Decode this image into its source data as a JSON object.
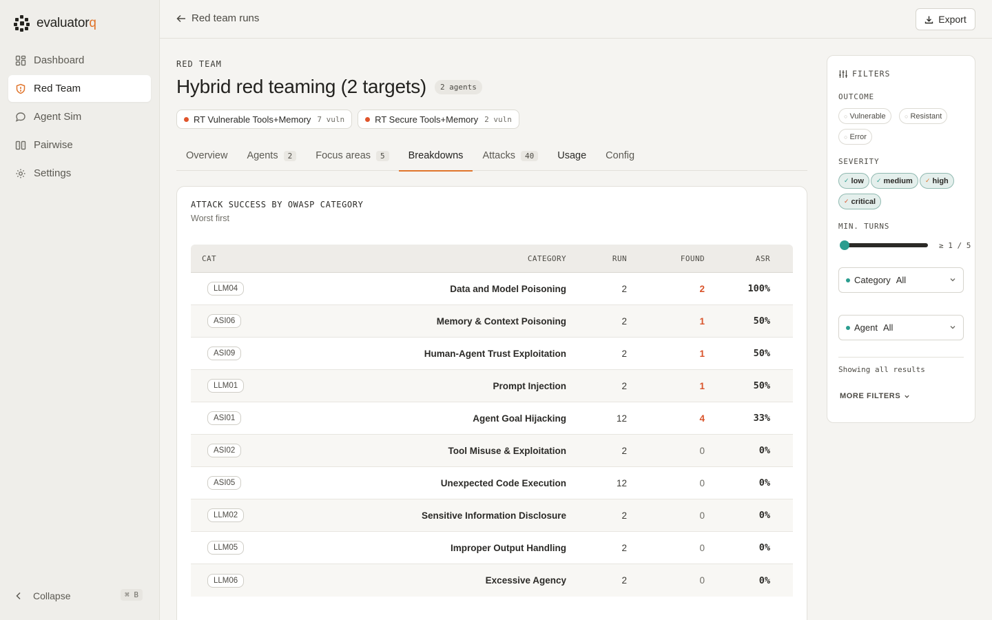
{
  "app": {
    "logo_text": "evaluator",
    "logo_accent": "q",
    "accent_color": "#e0742b",
    "teal_color": "#2a9d8f"
  },
  "sidebar": {
    "items": [
      {
        "label": "Dashboard",
        "icon": "dashboard-icon"
      },
      {
        "label": "Red Team",
        "icon": "shield-icon",
        "active": true
      },
      {
        "label": "Agent Sim",
        "icon": "chat-bubble-icon"
      },
      {
        "label": "Pairwise",
        "icon": "columns-icon"
      },
      {
        "label": "Settings",
        "icon": "gear-icon"
      }
    ],
    "collapse_label": "Collapse",
    "collapse_shortcut": "⌘ B"
  },
  "topbar": {
    "back_label": "Red team runs",
    "export_label": "Export"
  },
  "header": {
    "eyebrow": "RED TEAM",
    "title": "Hybrid red teaming (2 targets)",
    "agent_count": "2 agents",
    "targets": [
      {
        "name": "RT Vulnerable Tools+Memory",
        "vuln": "7 vuln"
      },
      {
        "name": "RT Secure Tools+Memory",
        "vuln": "2 vuln"
      }
    ]
  },
  "tabs": [
    {
      "label": "Overview"
    },
    {
      "label": "Agents",
      "badge": "2"
    },
    {
      "label": "Focus areas",
      "badge": "5"
    },
    {
      "label": "Breakdowns",
      "active": true
    },
    {
      "label": "Attacks",
      "badge": "40"
    },
    {
      "label": "Usage"
    },
    {
      "label": "Config"
    }
  ],
  "breakdown": {
    "title": "ATTACK SUCCESS BY OWASP CATEGORY",
    "subtitle": "Worst first",
    "columns": {
      "cat": "CAT",
      "category": "CATEGORY",
      "run": "RUN",
      "found": "FOUND",
      "asr": "ASR"
    },
    "rows": [
      {
        "cat": "LLM04",
        "category": "Data and Model Poisoning",
        "run": "2",
        "found": "2",
        "asr": "100%"
      },
      {
        "cat": "ASI06",
        "category": "Memory & Context Poisoning",
        "run": "2",
        "found": "1",
        "asr": "50%"
      },
      {
        "cat": "ASI09",
        "category": "Human-Agent Trust Exploitation",
        "run": "2",
        "found": "1",
        "asr": "50%"
      },
      {
        "cat": "LLM01",
        "category": "Prompt Injection",
        "run": "2",
        "found": "1",
        "asr": "50%"
      },
      {
        "cat": "ASI01",
        "category": "Agent Goal Hijacking",
        "run": "12",
        "found": "4",
        "asr": "33%"
      },
      {
        "cat": "ASI02",
        "category": "Tool Misuse & Exploitation",
        "run": "2",
        "found": "0",
        "asr": "0%"
      },
      {
        "cat": "ASI05",
        "category": "Unexpected Code Execution",
        "run": "12",
        "found": "0",
        "asr": "0%"
      },
      {
        "cat": "LLM02",
        "category": "Sensitive Information Disclosure",
        "run": "2",
        "found": "0",
        "asr": "0%"
      },
      {
        "cat": "LLM05",
        "category": "Improper Output Handling",
        "run": "2",
        "found": "0",
        "asr": "0%"
      },
      {
        "cat": "LLM06",
        "category": "Excessive Agency",
        "run": "2",
        "found": "0",
        "asr": "0%"
      }
    ]
  },
  "filters": {
    "title": "FILTERS",
    "outcome_label": "OUTCOME",
    "outcomes": [
      "Vulnerable",
      "Resistant",
      "Error"
    ],
    "severity_label": "SEVERITY",
    "severities": [
      "low",
      "medium",
      "high",
      "critical"
    ],
    "severity_colors": {
      "low": "#2a9d8f",
      "medium": "#2a9d8f",
      "high": "#e0742b",
      "critical": "#d9532a"
    },
    "min_turns_label": "MIN. TURNS",
    "min_turns_value": 1,
    "min_turns_max": 5,
    "min_turns_display": "≥ 1 / 5",
    "category_label": "Category",
    "category_value": "All",
    "agent_label": "Agent",
    "agent_value": "All",
    "showing_text": "Showing all results",
    "more_filters_label": "MORE FILTERS"
  }
}
